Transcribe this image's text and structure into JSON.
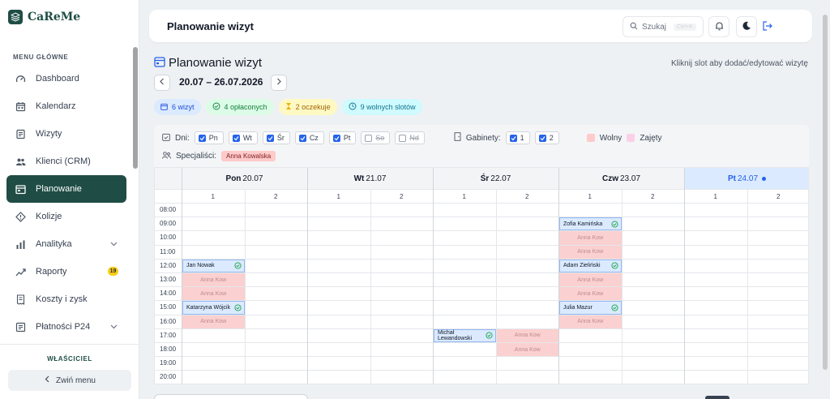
{
  "brand": {
    "name": "CaReMe"
  },
  "sidebar": {
    "caption": "MENU GŁÓWNE",
    "items": [
      {
        "label": "Dashboard",
        "icon": "dashboard-icon"
      },
      {
        "label": "Kalendarz",
        "icon": "calendar-icon"
      },
      {
        "label": "Wizyty",
        "icon": "visits-icon"
      },
      {
        "label": "Klienci (CRM)",
        "icon": "users-icon"
      },
      {
        "label": "Planowanie",
        "icon": "planning-icon",
        "active": true
      },
      {
        "label": "Kolizje",
        "icon": "warning-icon"
      },
      {
        "label": "Analityka",
        "icon": "chart-icon",
        "expandable": true
      },
      {
        "label": "Raporty",
        "icon": "report-icon",
        "badge": "19"
      },
      {
        "label": "Koszty i zysk",
        "icon": "receipt-icon"
      },
      {
        "label": "Płatności P24",
        "icon": "card-icon",
        "expandable": true
      }
    ],
    "role": "WŁAŚCICIEL",
    "collapse_label": "Zwiń menu"
  },
  "topbar": {
    "title": "Planowanie wizyt",
    "search_label": "Szukaj",
    "search_shortcut": "Ctrl+K"
  },
  "header": {
    "title": "Planowanie wizyt",
    "hint": "Kliknij slot aby dodać/edytować wizytę",
    "range": "20.07 – 26.07.2026"
  },
  "stats": {
    "visits": "6 wizyt",
    "paid": "4 opłaconych",
    "pending": "2 oczekuje",
    "free": "9 wolnych slotów"
  },
  "filters": {
    "days_label": "Dni:",
    "days": [
      {
        "label": "Pn",
        "checked": true
      },
      {
        "label": "Wt",
        "checked": true
      },
      {
        "label": "Śr",
        "checked": true
      },
      {
        "label": "Cz",
        "checked": true
      },
      {
        "label": "Pt",
        "checked": true
      },
      {
        "label": "So",
        "checked": false
      },
      {
        "label": "Nd",
        "checked": false
      }
    ],
    "rooms_label": "Gabinety:",
    "rooms": [
      {
        "label": "1",
        "checked": true
      },
      {
        "label": "2",
        "checked": true
      }
    ],
    "legend_free": "Wolny",
    "legend_busy": "Zajęty",
    "spec_label": "Specjaliści:",
    "spec_name": "Anna Kowalska"
  },
  "colors": {
    "accent": "#1f4d45",
    "primary": "#2563eb",
    "booked": "#dbeafe",
    "busy": "#fbd0d0"
  },
  "calendar": {
    "days": [
      {
        "name": "Pon",
        "date": "20.07",
        "today": false
      },
      {
        "name": "Wt",
        "date": "21.07",
        "today": false
      },
      {
        "name": "Śr",
        "date": "22.07",
        "today": false
      },
      {
        "name": "Czw",
        "date": "23.07",
        "today": false
      },
      {
        "name": "Pt",
        "date": "24.07",
        "today": true
      }
    ],
    "rooms": [
      "1",
      "2"
    ],
    "hours": [
      "08:00",
      "09:00",
      "10:00",
      "11:00",
      "12:00",
      "13:00",
      "14:00",
      "15:00",
      "16:00",
      "17:00",
      "18:00",
      "19:00",
      "20:00"
    ],
    "slots": [
      {
        "day": 0,
        "room": 0,
        "hour": "12:00",
        "type": "booked",
        "label": "Jan Nowak"
      },
      {
        "day": 0,
        "room": 0,
        "hour": "13:00",
        "type": "busy",
        "label": "Anna Kow"
      },
      {
        "day": 0,
        "room": 0,
        "hour": "14:00",
        "type": "busy",
        "label": "Anna Kow"
      },
      {
        "day": 0,
        "room": 0,
        "hour": "15:00",
        "type": "booked",
        "label": "Katarzyna Wójcik"
      },
      {
        "day": 0,
        "room": 0,
        "hour": "16:00",
        "type": "busy",
        "label": "Anna Kow"
      },
      {
        "day": 2,
        "room": 0,
        "hour": "17:00",
        "type": "booked",
        "label": "Michał Lewandowski"
      },
      {
        "day": 2,
        "room": 1,
        "hour": "17:00",
        "type": "busy",
        "label": "Anna Kow"
      },
      {
        "day": 2,
        "room": 1,
        "hour": "18:00",
        "type": "busy",
        "label": "Anna Kow"
      },
      {
        "day": 3,
        "room": 0,
        "hour": "09:00",
        "type": "booked",
        "label": "Zofia Kamińska"
      },
      {
        "day": 3,
        "room": 0,
        "hour": "10:00",
        "type": "busy",
        "label": "Anna Kow"
      },
      {
        "day": 3,
        "room": 0,
        "hour": "11:00",
        "type": "busy",
        "label": "Anna Kow"
      },
      {
        "day": 3,
        "room": 0,
        "hour": "12:00",
        "type": "booked",
        "label": "Adam Zieliński"
      },
      {
        "day": 3,
        "room": 0,
        "hour": "13:00",
        "type": "busy",
        "label": "Anna Kow"
      },
      {
        "day": 3,
        "room": 0,
        "hour": "14:00",
        "type": "busy",
        "label": "Anna Kow"
      },
      {
        "day": 3,
        "room": 0,
        "hour": "15:00",
        "type": "booked",
        "label": "Julia Mazur"
      },
      {
        "day": 3,
        "room": 0,
        "hour": "16:00",
        "type": "busy",
        "label": "Anna Kow"
      }
    ]
  }
}
